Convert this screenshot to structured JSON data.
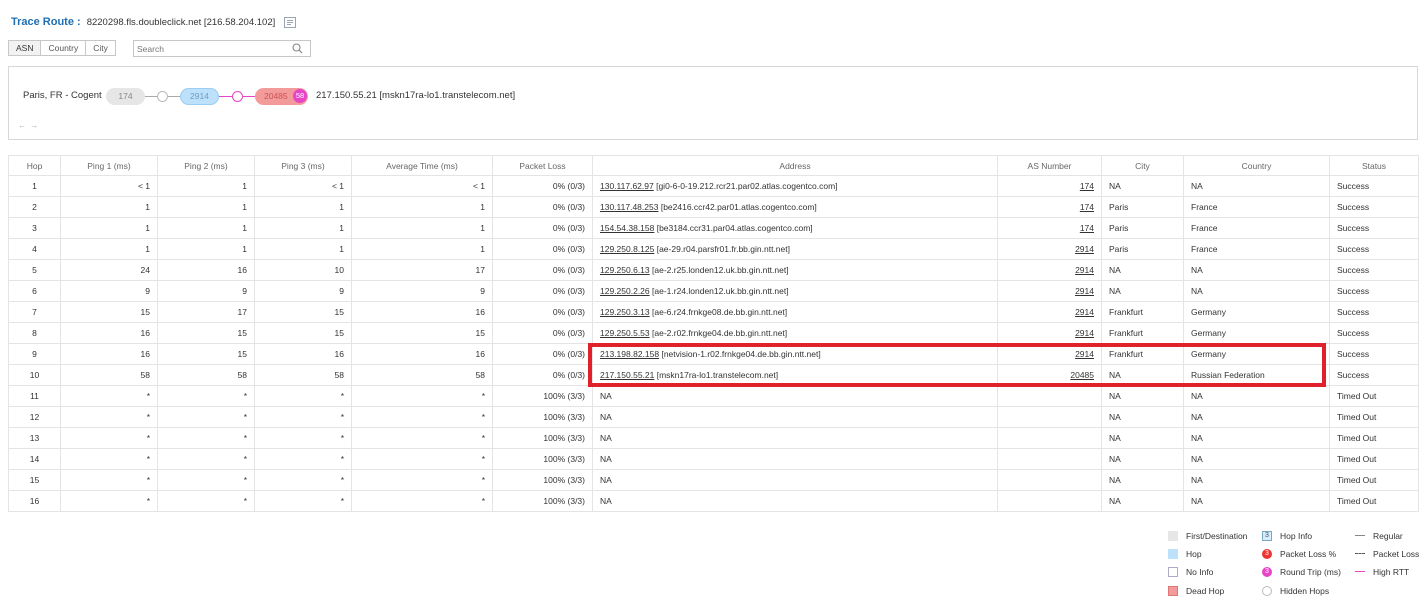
{
  "header": {
    "title": "Trace Route :",
    "target": "8220298.fls.doubleclick.net [216.58.204.102]"
  },
  "view_toggle": [
    "ASN",
    "Country",
    "City"
  ],
  "search": {
    "placeholder": "Search"
  },
  "path": {
    "source": "Paris, FR - Cogent",
    "nodes": [
      "174",
      "2914",
      "20485"
    ],
    "loss_badge": "58",
    "destination": "217.150.55.21 [mskn17ra-lo1.transtelecom.net]",
    "nav_arrows": "← →"
  },
  "table": {
    "headers": [
      "Hop",
      "Ping 1 (ms)",
      "Ping 2 (ms)",
      "Ping 3 (ms)",
      "Average Time (ms)",
      "Packet Loss",
      "Address",
      "AS Number",
      "City",
      "Country",
      "Status"
    ],
    "rows": [
      {
        "hop": "1",
        "p1": "< 1",
        "p2": "1",
        "p3": "< 1",
        "avg": "< 1",
        "loss": "0% (0/3)",
        "ip": "130.117.62.97",
        "host": " [gi0-6-0-19.212.rcr21.par02.atlas.cogentco.com]",
        "asn": "174",
        "city": "NA",
        "country": "NA",
        "status": "Success"
      },
      {
        "hop": "2",
        "p1": "1",
        "p2": "1",
        "p3": "1",
        "avg": "1",
        "loss": "0% (0/3)",
        "ip": "130.117.48.253",
        "host": " [be2416.ccr42.par01.atlas.cogentco.com]",
        "asn": "174",
        "city": "Paris",
        "country": "France",
        "status": "Success"
      },
      {
        "hop": "3",
        "p1": "1",
        "p2": "1",
        "p3": "1",
        "avg": "1",
        "loss": "0% (0/3)",
        "ip": "154.54.38.158",
        "host": " [be3184.ccr31.par04.atlas.cogentco.com]",
        "asn": "174",
        "city": "Paris",
        "country": "France",
        "status": "Success"
      },
      {
        "hop": "4",
        "p1": "1",
        "p2": "1",
        "p3": "1",
        "avg": "1",
        "loss": "0% (0/3)",
        "ip": "129.250.8.125",
        "host": " [ae-29.r04.parsfr01.fr.bb.gin.ntt.net]",
        "asn": "2914",
        "city": "Paris",
        "country": "France",
        "status": "Success"
      },
      {
        "hop": "5",
        "p1": "24",
        "p2": "16",
        "p3": "10",
        "avg": "17",
        "loss": "0% (0/3)",
        "ip": "129.250.6.13",
        "host": " [ae-2.r25.londen12.uk.bb.gin.ntt.net]",
        "asn": "2914",
        "city": "NA",
        "country": "NA",
        "status": "Success"
      },
      {
        "hop": "6",
        "p1": "9",
        "p2": "9",
        "p3": "9",
        "avg": "9",
        "loss": "0% (0/3)",
        "ip": "129.250.2.26",
        "host": " [ae-1.r24.londen12.uk.bb.gin.ntt.net]",
        "asn": "2914",
        "city": "NA",
        "country": "NA",
        "status": "Success"
      },
      {
        "hop": "7",
        "p1": "15",
        "p2": "17",
        "p3": "15",
        "avg": "16",
        "loss": "0% (0/3)",
        "ip": "129.250.3.13",
        "host": " [ae-6.r24.frnkge08.de.bb.gin.ntt.net]",
        "asn": "2914",
        "city": "Frankfurt",
        "country": "Germany",
        "status": "Success"
      },
      {
        "hop": "8",
        "p1": "16",
        "p2": "15",
        "p3": "15",
        "avg": "15",
        "loss": "0% (0/3)",
        "ip": "129.250.5.53",
        "host": " [ae-2.r02.frnkge04.de.bb.gin.ntt.net]",
        "asn": "2914",
        "city": "Frankfurt",
        "country": "Germany",
        "status": "Success"
      },
      {
        "hop": "9",
        "p1": "16",
        "p2": "15",
        "p3": "16",
        "avg": "16",
        "loss": "0% (0/3)",
        "ip": "213.198.82.158",
        "host": " [netvision-1.r02.frnkge04.de.bb.gin.ntt.net]",
        "asn": "2914",
        "city": "Frankfurt",
        "country": "Germany",
        "status": "Success"
      },
      {
        "hop": "10",
        "p1": "58",
        "p2": "58",
        "p3": "58",
        "avg": "58",
        "loss": "0% (0/3)",
        "ip": "217.150.55.21",
        "host": " [mskn17ra-lo1.transtelecom.net]",
        "asn": "20485",
        "city": "NA",
        "country": "Russian Federation",
        "status": "Success"
      },
      {
        "hop": "11",
        "p1": "*",
        "p2": "*",
        "p3": "*",
        "avg": "*",
        "loss": "100% (3/3)",
        "ip": "",
        "host": "NA",
        "asn": "",
        "city": "NA",
        "country": "NA",
        "status": "Timed Out"
      },
      {
        "hop": "12",
        "p1": "*",
        "p2": "*",
        "p3": "*",
        "avg": "*",
        "loss": "100% (3/3)",
        "ip": "",
        "host": "NA",
        "asn": "",
        "city": "NA",
        "country": "NA",
        "status": "Timed Out"
      },
      {
        "hop": "13",
        "p1": "*",
        "p2": "*",
        "p3": "*",
        "avg": "*",
        "loss": "100% (3/3)",
        "ip": "",
        "host": "NA",
        "asn": "",
        "city": "NA",
        "country": "NA",
        "status": "Timed Out"
      },
      {
        "hop": "14",
        "p1": "*",
        "p2": "*",
        "p3": "*",
        "avg": "*",
        "loss": "100% (3/3)",
        "ip": "",
        "host": "NA",
        "asn": "",
        "city": "NA",
        "country": "NA",
        "status": "Timed Out"
      },
      {
        "hop": "15",
        "p1": "*",
        "p2": "*",
        "p3": "*",
        "avg": "*",
        "loss": "100% (3/3)",
        "ip": "",
        "host": "NA",
        "asn": "",
        "city": "NA",
        "country": "NA",
        "status": "Timed Out"
      },
      {
        "hop": "16",
        "p1": "*",
        "p2": "*",
        "p3": "*",
        "avg": "*",
        "loss": "100% (3/3)",
        "ip": "",
        "host": "NA",
        "asn": "",
        "city": "NA",
        "country": "NA",
        "status": "Timed Out"
      }
    ]
  },
  "legend": {
    "first_destination": "First/Destination",
    "hop": "Hop",
    "no_info": "No Info",
    "dead_hop": "Dead Hop",
    "hop_info": "Hop Info",
    "hop_info_badge": "3",
    "packet_loss": "Packet Loss %",
    "packet_loss_badge": "3",
    "round_trip": "Round Trip (ms)",
    "round_trip_badge": "3",
    "hidden_hops": "Hidden Hops",
    "regular": "Regular",
    "packet_loss_line": "Packet Loss",
    "high_rtt": "High RTT"
  },
  "colors": {
    "title_blue": "#1f6fb2",
    "asn_node": "#bde0fb",
    "dead_hop": "#f39a9a",
    "high_rtt": "#e645c8",
    "highlight_red": "#e0202a"
  }
}
